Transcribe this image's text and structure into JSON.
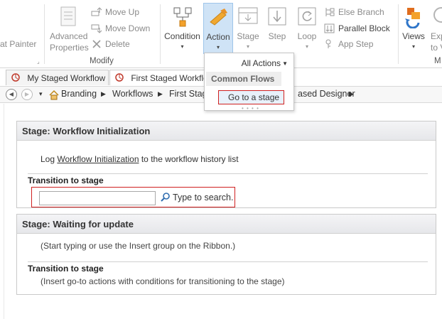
{
  "ribbon": {
    "format_painter": "at Painter",
    "advanced_properties": [
      "Advanced",
      "Properties"
    ],
    "move_up": "Move Up",
    "move_down": "Move Down",
    "delete": "Delete",
    "group_modify": "Modify",
    "condition": "Condition",
    "action": "Action",
    "stage": "Stage",
    "step": "Step",
    "loop": "Loop",
    "else_branch": "Else Branch",
    "parallel_block": "Parallel Block",
    "app_step": "App Step",
    "views": "Views",
    "export_partial": [
      "Exp",
      "to V"
    ],
    "group_m_partial": "M",
    "colors": {
      "active_bg": "#cfe3f6",
      "active_border": "#9ec5ea"
    }
  },
  "tabs": [
    {
      "label": "My Staged Workflow"
    },
    {
      "label": "First Staged Workflo"
    }
  ],
  "breadcrumb": {
    "items": [
      "Branding",
      "Workflows",
      "First Stag",
      "ased Designer"
    ]
  },
  "dropdown": {
    "all_actions": "All Actions",
    "category": "Common Flows",
    "item": "Go to a stage"
  },
  "stages": [
    {
      "title": "Stage: Workflow Initialization",
      "log_prefix": "Log ",
      "log_link": "Workflow Initialization",
      "log_suffix": " to the workflow history list",
      "transition_label": "Transition to stage",
      "search_value": "",
      "search_hint": "Type to search."
    },
    {
      "title": "Stage: Waiting for update",
      "hint": "(Start typing or use the Insert group on the Ribbon.)",
      "transition_label": "Transition to stage",
      "transition_hint": "(Insert go-to actions with conditions for transitioning to the stage)"
    }
  ]
}
